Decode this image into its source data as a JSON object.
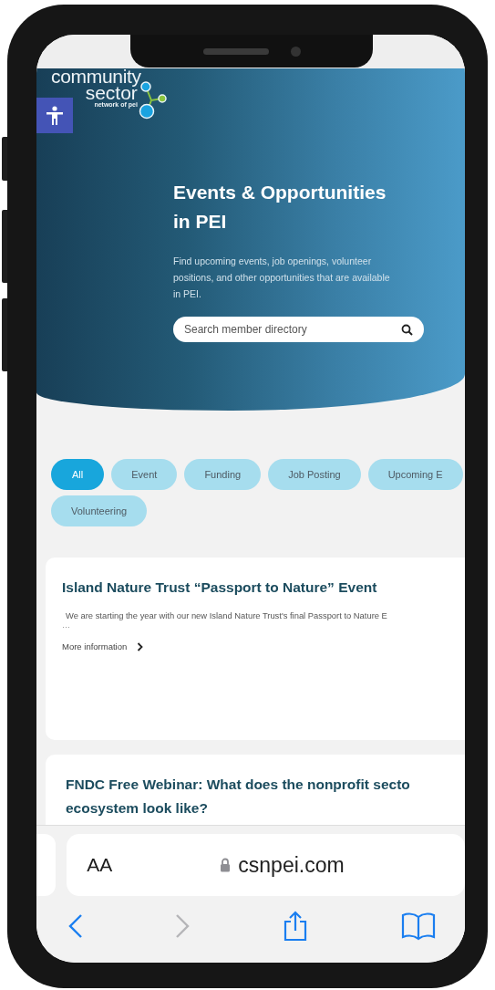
{
  "site": {
    "logo": [
      "community",
      "sector",
      "network of pei"
    ]
  },
  "hero": {
    "title": "Events & Opportunities in PEI",
    "description": "Find upcoming events, job openings, volunteer positions, and other opportunities that are available in PEI.",
    "search": {
      "placeholder": "Search member directory"
    }
  },
  "filters": [
    {
      "label": "All",
      "selected": true
    },
    {
      "label": "Event",
      "selected": false
    },
    {
      "label": "Funding",
      "selected": false
    },
    {
      "label": "Job Posting",
      "selected": false
    },
    {
      "label": "Upcoming E",
      "selected": false
    },
    {
      "label": "Volunteering",
      "selected": false
    }
  ],
  "cards": [
    {
      "title_lines": [
        "Island Nature Trust “Passport to Nature” Event"
      ],
      "excerpt": "We are starting the year with our new Island Nature Trust's final Passport to Nature E",
      "ellipsis": "…",
      "link": "More information"
    },
    {
      "title_lines": [
        "FNDC Free Webinar: What does the nonprofit secto",
        "ecosystem look like?"
      ]
    }
  ],
  "browser": {
    "text_size": "AA",
    "url": "csnpei.com",
    "forward_disabled": true
  }
}
